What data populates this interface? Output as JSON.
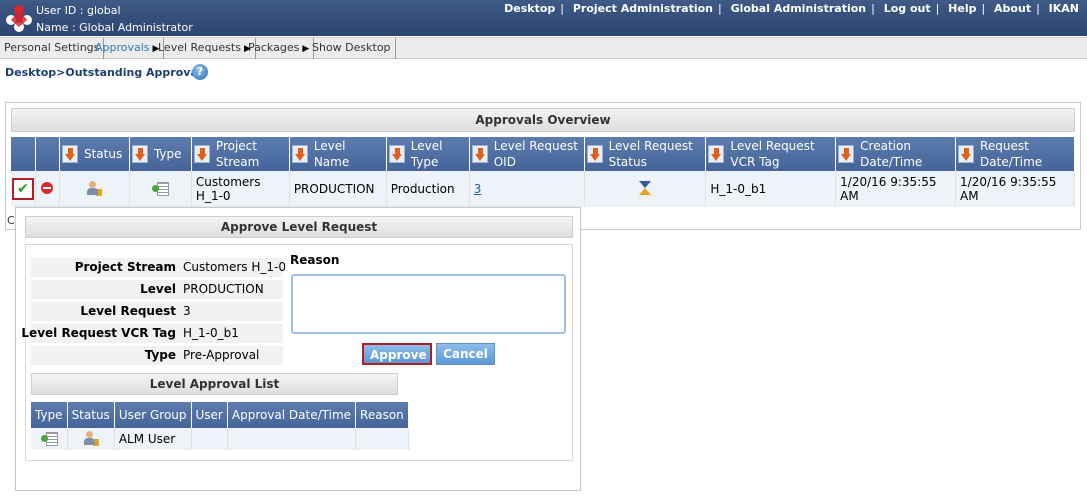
{
  "header": {
    "user_id": "User ID : global",
    "user_name": "Name : Global Administrator",
    "nav": [
      "Desktop",
      "Project Administration",
      "Global Administration",
      "Log out",
      "Help",
      "About",
      "IKAN"
    ]
  },
  "subnav": {
    "items": [
      "Personal Settings",
      "Approvals",
      "Level Requests",
      "Packages",
      "Show Desktop"
    ],
    "active": "Approvals"
  },
  "breadcrumb": "Desktop>Outstanding Approvals",
  "overview": {
    "title": "Approvals Overview",
    "columns": {
      "status": "Status",
      "type": "Type",
      "project_stream": "Project Stream",
      "level_name": "Level Name",
      "level_type": "Level Type",
      "level_request_oid": "Level Request OID",
      "level_request_status": "Level Request Status",
      "level_request_vcr_tag": "Level Request VCR Tag",
      "creation_datetime": "Creation Date/Time",
      "request_datetime": "Request Date/Time"
    },
    "row": {
      "project_stream": "Customers H_1-0",
      "level_name": "PRODUCTION",
      "level_type": "Production",
      "level_request_oid": "3",
      "level_request_vcr_tag": "H_1-0_b1",
      "creation_datetime": "1/20/16 9:35:55 AM",
      "request_datetime": "1/20/16 9:35:55 AM"
    },
    "cut_text": "C"
  },
  "popup": {
    "title": "Approve Level Request",
    "fields": {
      "project_stream_label": "Project Stream",
      "project_stream_value": "Customers H_1-0",
      "level_label": "Level",
      "level_value": "PRODUCTION",
      "level_request_label": "Level Request",
      "level_request_value": "3",
      "vcr_tag_label": "Level Request VCR Tag",
      "vcr_tag_value": "H_1-0_b1",
      "type_label": "Type",
      "type_value": "Pre-Approval"
    },
    "reason_label": "Reason",
    "reason_value": "",
    "approve_label": "Approve",
    "cancel_label": "Cancel",
    "approval_list": {
      "title": "Level Approval List",
      "columns": [
        "Type",
        "Status",
        "User Group",
        "User",
        "Approval Date/Time",
        "Reason"
      ],
      "row": {
        "user_group": "ALM User",
        "user": "",
        "approval_datetime": "",
        "reason": ""
      }
    }
  },
  "colors": {
    "header_bg": "#2d4572",
    "table_header_bg": "#4f6ea3",
    "highlight_border": "#b21e27",
    "link": "#2a5fb0"
  }
}
